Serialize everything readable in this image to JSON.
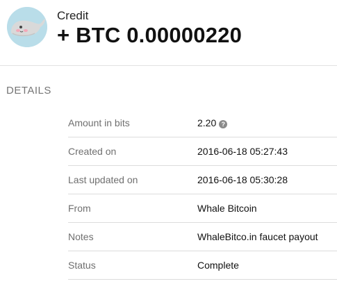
{
  "header": {
    "avatar_icon": "whale-icon",
    "type_label": "Credit",
    "amount": "+ BTC 0.00000220"
  },
  "details": {
    "title": "DETAILS",
    "rows": [
      {
        "label": "Amount in bits",
        "value": "2.20",
        "help_icon": "question-icon"
      },
      {
        "label": "Created on",
        "value": "2016-06-18 05:27:43"
      },
      {
        "label": "Last updated on",
        "value": "2016-06-18 05:30:28"
      },
      {
        "label": "From",
        "value": "Whale Bitcoin"
      },
      {
        "label": "Notes",
        "value": "WhaleBitco.in faucet payout"
      },
      {
        "label": "Status",
        "value": "Complete"
      }
    ]
  },
  "colors": {
    "avatar_bg": "#b9dde9",
    "whale_body": "#d9d9d9",
    "label_gray": "#6f6f6f"
  }
}
